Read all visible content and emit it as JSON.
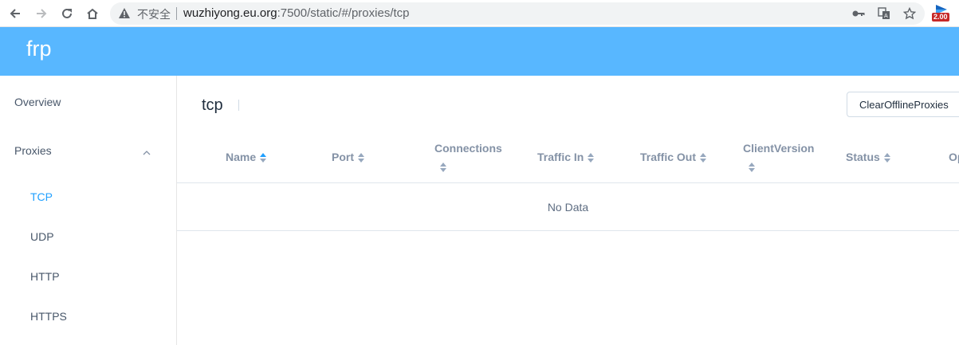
{
  "browser": {
    "insecure_label": "不安全",
    "url_host": "wuzhiyong.eu.org",
    "url_path": ":7500/static/#/proxies/tcp",
    "extension_badge": "2.00",
    "icons": [
      "back-icon",
      "forward-icon",
      "reload-icon",
      "home-icon",
      "warning-icon",
      "key-icon",
      "translate-icon",
      "star-icon",
      "extension-icon"
    ]
  },
  "app": {
    "brand": "frp",
    "header_color": "#58b7ff",
    "accent_color": "#20a0ff"
  },
  "sidebar": {
    "items": [
      {
        "label": "Overview"
      },
      {
        "label": "Proxies",
        "expanded": true
      }
    ],
    "submenu": [
      {
        "label": "TCP",
        "active": true
      },
      {
        "label": "UDP"
      },
      {
        "label": "HTTP"
      },
      {
        "label": "HTTPS"
      }
    ]
  },
  "main": {
    "title": "tcp",
    "clear_button": "ClearOfflineProxies",
    "columns": [
      {
        "label": "Name",
        "sort_active": true
      },
      {
        "label": "Port"
      },
      {
        "label": "Connections"
      },
      {
        "label": "Traffic In"
      },
      {
        "label": "Traffic Out"
      },
      {
        "label": "ClientVersion"
      },
      {
        "label": "Status"
      },
      {
        "label": "Op"
      }
    ],
    "empty_text": "No Data"
  }
}
